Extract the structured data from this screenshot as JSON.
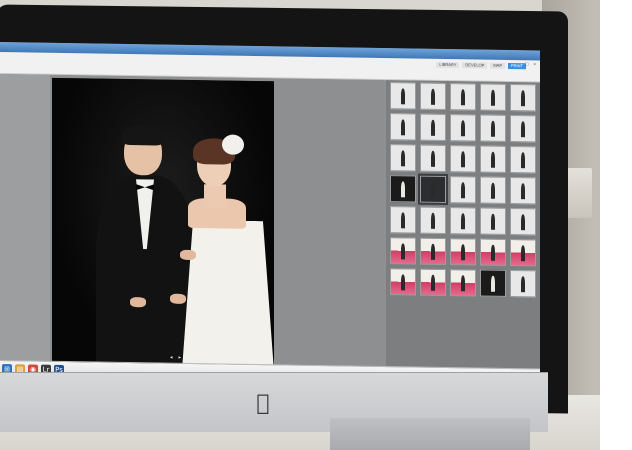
{
  "app": {
    "tabs": [
      {
        "label": "LIBRARY"
      },
      {
        "label": "DEVELOP"
      },
      {
        "label": "MAP"
      },
      {
        "label": "PRINT",
        "active": true
      }
    ],
    "window_controls": [
      "–",
      "□",
      "×"
    ]
  },
  "viewer": {
    "bottom_icons": [
      "◂",
      "▸"
    ]
  },
  "filmstrip": {
    "thumbs": [
      {
        "tone": "light"
      },
      {
        "tone": "light"
      },
      {
        "tone": "light"
      },
      {
        "tone": "light"
      },
      {
        "tone": "light"
      },
      {
        "tone": "light"
      },
      {
        "tone": "light"
      },
      {
        "tone": "light"
      },
      {
        "tone": "light"
      },
      {
        "tone": "light"
      },
      {
        "tone": "light"
      },
      {
        "tone": "light"
      },
      {
        "tone": "light"
      },
      {
        "tone": "light"
      },
      {
        "tone": "light"
      },
      {
        "tone": "dark"
      },
      {
        "tone": "selected"
      },
      {
        "tone": "light"
      },
      {
        "tone": "light"
      },
      {
        "tone": "light"
      },
      {
        "tone": "light"
      },
      {
        "tone": "light"
      },
      {
        "tone": "light"
      },
      {
        "tone": "light"
      },
      {
        "tone": "light"
      },
      {
        "tone": "color"
      },
      {
        "tone": "color"
      },
      {
        "tone": "color"
      },
      {
        "tone": "color"
      },
      {
        "tone": "color"
      },
      {
        "tone": "color"
      },
      {
        "tone": "color"
      },
      {
        "tone": "color"
      },
      {
        "tone": "dark"
      },
      {
        "tone": "light"
      }
    ]
  },
  "taskbar": {
    "icons": [
      {
        "icon": "start-icon",
        "color": "#2f6fc0",
        "glyph": "⊞"
      },
      {
        "icon": "explorer-icon",
        "color": "#d9a23a",
        "glyph": "▤"
      },
      {
        "icon": "browser-icon",
        "color": "#d04a3a",
        "glyph": "◉"
      },
      {
        "icon": "lightroom-icon",
        "color": "#3a3a3a",
        "glyph": "Lr"
      },
      {
        "icon": "photoshop-icon",
        "color": "#1f4f8f",
        "glyph": "Ps"
      }
    ],
    "tray_glyphs": [
      "▲",
      "◆",
      "♪",
      "▦"
    ]
  },
  "monitor": {
    "logo": "apple-logo"
  }
}
